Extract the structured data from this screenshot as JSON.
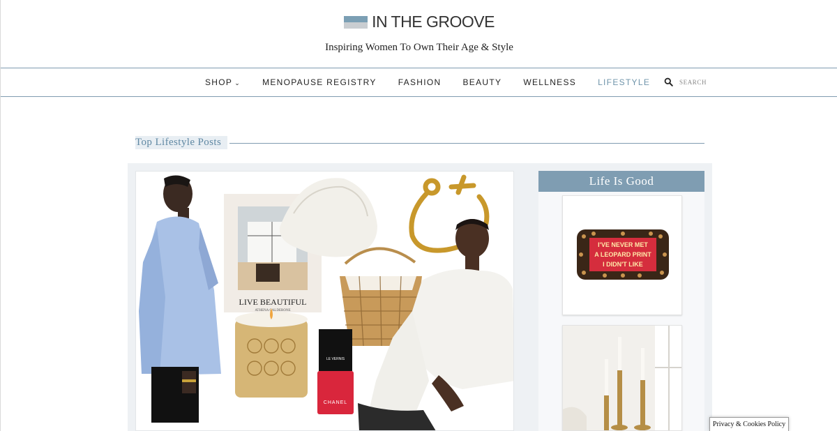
{
  "header": {
    "brand_name": "IN THE GROOVE",
    "tagline": "Inspiring Women To Own Their Age & Style",
    "logo_colors": [
      "#7b9fb4",
      "#c9cdd1"
    ]
  },
  "nav": {
    "items": [
      {
        "label": "SHOP",
        "has_dropdown": true
      },
      {
        "label": "MENOPAUSE REGISTRY"
      },
      {
        "label": "FASHION"
      },
      {
        "label": "BEAUTY"
      },
      {
        "label": "WELLNESS"
      },
      {
        "label": "LIFESTYLE",
        "active": true
      }
    ],
    "search_placeholder": "SEARCH",
    "search_icon": "search-icon"
  },
  "section": {
    "title": "Top Lifestyle Posts"
  },
  "feature": {
    "book_title": "LIVE BEAUTIFUL",
    "book_author": "ATHENA CALDERONE",
    "nail_polish_label": "LE VERNIS",
    "nail_polish_brand": "CHANEL"
  },
  "sidebar": {
    "widget_title": "Life Is Good",
    "pillow_text": [
      "I'VE NEVER MET",
      "A LEOPARD PRINT",
      "I DIDN'T LIKE"
    ]
  },
  "footer": {
    "privacy_label": "Privacy & Cookies Policy"
  },
  "colors": {
    "accent": "#6f94aa",
    "rule": "#7f9bb0",
    "widget_bg": "#7f9db2",
    "panel_bg": "#eef1f4"
  }
}
